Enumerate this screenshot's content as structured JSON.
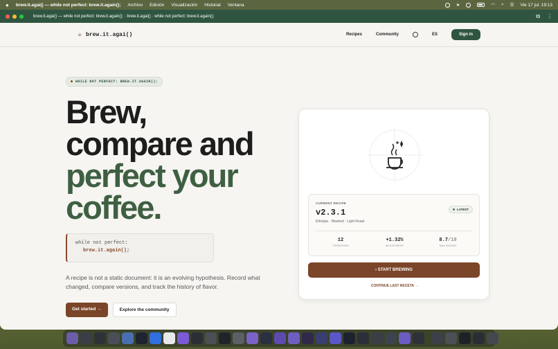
{
  "menubar": {
    "app_name": "brew.it.agai() — while not perfect: brew.it.again();",
    "items": [
      "Archivo",
      "Edición",
      "Visualización",
      "Historial",
      "Ventana"
    ],
    "datetime": "Vie 17 jul. 19:13"
  },
  "browser": {
    "tab_title": "brew.it.agai() — while not perfect: brew.it.again(); · brew.it.agai() · while not perfect: brew.it.again();"
  },
  "nav": {
    "logo_text": "brew.it.agai()",
    "links": [
      "Recipes",
      "Community"
    ],
    "language": "ES",
    "signin_label": "Sign in"
  },
  "hero": {
    "pill_label": "WHILE NOT PERFECT: BREW.IT.AGAIN();",
    "headline_line1": "Brew,",
    "headline_line2": "compare and",
    "headline_line3": "perfect your",
    "headline_line4": "coffee.",
    "code_line1": "while not perfect:",
    "code_line2": "brew.it.again();",
    "description": "A recipe is not a static document: it is an evolving hypothesis. Record what changed, compare versions, and track the history of flavor.",
    "cta_primary": "Get started",
    "cta_primary_arrow": "→",
    "cta_secondary": "Explore the community"
  },
  "card": {
    "label": "CURRENT RECIPE",
    "version": "v2.3.1",
    "origin": "Ethiopia · Washed · Light Roast",
    "badge": "LATEST",
    "stats": [
      {
        "value": "12",
        "suffix": "",
        "label": "ITERATIONS"
      },
      {
        "value": "+1.32%",
        "suffix": "",
        "label": "ADJUSTMENT"
      },
      {
        "value": "8.7",
        "suffix": "/10",
        "label": "MAX RATING"
      }
    ],
    "start_label": "› START BREWING",
    "continue_label": "CONTINUE LAST RECETA →"
  },
  "colors": {
    "brand_green": "#2f5540",
    "accent_brown": "#7a4528",
    "headline_green": "#3f5f43"
  },
  "dock": {
    "icon_colors": [
      "#6b5da8",
      "#3a3f47",
      "#2e3238",
      "#4a4f57",
      "#4a6fb0",
      "#1e2430",
      "#2f6fe0",
      "#e8e8ea",
      "#7a5ad6",
      "#2a2f36",
      "#4a4f56",
      "#1f242b",
      "#5b5f66",
      "#7b62c9",
      "#2a3040",
      "#5d4bb0",
      "#6d5ec0",
      "#2f2a4a",
      "#3a3f70",
      "#5a57c8",
      "#1c2230",
      "#2b2f3a",
      "#3a3f46",
      "#3e444d",
      "#6a5cc2",
      "#2d3138",
      "#3c4048",
      "#4b5057",
      "#1e2228",
      "#2a2e34",
      "#44484f"
    ]
  }
}
